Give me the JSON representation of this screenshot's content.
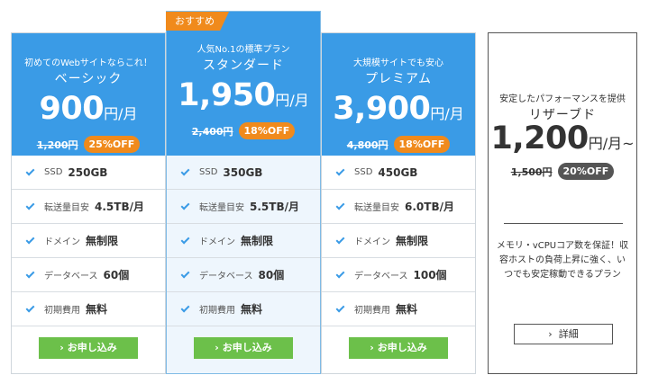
{
  "ribbon": "おすすめ",
  "plans": [
    {
      "tagline": "初めてのWebサイトならこれ！",
      "name": "ベーシック",
      "price": "900",
      "unit": "円/月",
      "original": "1,200円",
      "discount": "25%OFF",
      "features": [
        {
          "label": "SSD",
          "value": "250GB"
        },
        {
          "label": "転送量目安",
          "value": "4.5TB/月"
        },
        {
          "label": "ドメイン",
          "value": "無制限"
        },
        {
          "label": "データベース",
          "value": "60個"
        },
        {
          "label": "初期費用",
          "value": "無料"
        }
      ],
      "button": "お申し込み"
    },
    {
      "tagline": "人気No.1の標準プラン",
      "name": "スタンダード",
      "price": "1,950",
      "unit": "円/月",
      "original": "2,400円",
      "discount": "18%OFF",
      "features": [
        {
          "label": "SSD",
          "value": "350GB"
        },
        {
          "label": "転送量目安",
          "value": "5.5TB/月"
        },
        {
          "label": "ドメイン",
          "value": "無制限"
        },
        {
          "label": "データベース",
          "value": "80個"
        },
        {
          "label": "初期費用",
          "value": "無料"
        }
      ],
      "button": "お申し込み"
    },
    {
      "tagline": "大規模サイトでも安心",
      "name": "プレミアム",
      "price": "3,900",
      "unit": "円/月",
      "original": "4,800円",
      "discount": "18%OFF",
      "features": [
        {
          "label": "SSD",
          "value": "450GB"
        },
        {
          "label": "転送量目安",
          "value": "6.0TB/月"
        },
        {
          "label": "ドメイン",
          "value": "無制限"
        },
        {
          "label": "データベース",
          "value": "100個"
        },
        {
          "label": "初期費用",
          "value": "無料"
        }
      ],
      "button": "お申し込み"
    }
  ],
  "reserved": {
    "tagline": "安定したパフォーマンスを提供",
    "name": "リザーブド",
    "price": "1,200",
    "unit": "円/月~",
    "original": "1,500円",
    "discount": "20%OFF",
    "description": "メモリ・vCPUコア数を保証！収容ホストの負荷上昇に強く、いつでも安定稼動できるプラン",
    "button": "詳細"
  },
  "colors": {
    "primary": "#3a9be6",
    "accent": "#f08a1c",
    "cta": "#6cc04a",
    "featured_bg": "#eef6fd"
  },
  "icons": {
    "check": "check-icon",
    "chevron": "chevron-right-icon"
  }
}
